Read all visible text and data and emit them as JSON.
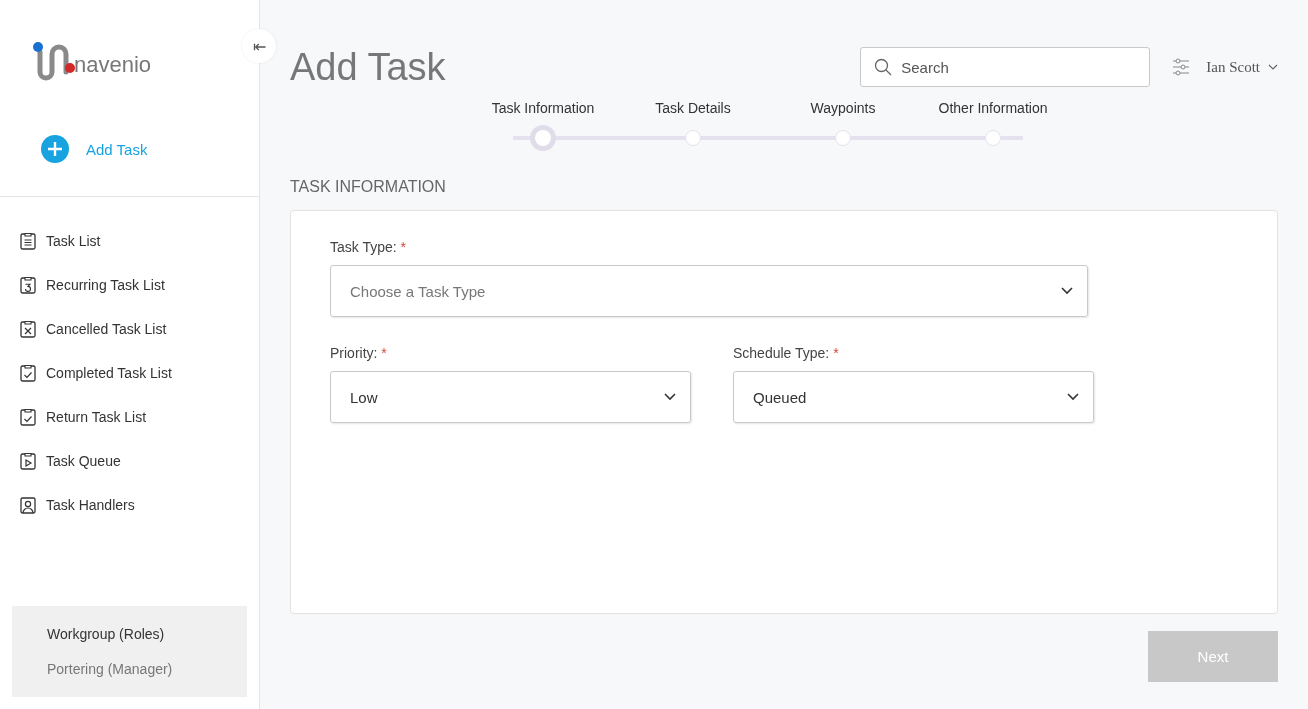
{
  "sidebar": {
    "logo_text": "navenio",
    "collapse_button": "⇤",
    "add_task": "Add Task",
    "items": [
      {
        "label": "Task List",
        "kind": "list"
      },
      {
        "label": "Recurring Task List",
        "kind": "recurring"
      },
      {
        "label": "Cancelled Task List",
        "kind": "cancelled"
      },
      {
        "label": "Completed Task List",
        "kind": "completed"
      },
      {
        "label": "Return Task List",
        "kind": "completed"
      },
      {
        "label": "Task Queue",
        "kind": "queue"
      },
      {
        "label": "Task Handlers",
        "kind": "person"
      }
    ],
    "workgroup": {
      "title": "Workgroup (Roles)",
      "role": "Portering (Manager)"
    }
  },
  "header": {
    "title": "Add Task",
    "search": {
      "placeholder": "Search"
    },
    "user": "Ian Scott"
  },
  "steps": [
    {
      "label": "Task Information",
      "selected": true
    },
    {
      "label": "Task Details",
      "selected": false
    },
    {
      "label": "Waypoints",
      "selected": false
    },
    {
      "label": "Other Information",
      "selected": false
    }
  ],
  "section_title": "TASK INFORMATION",
  "fields": [
    {
      "label": "Task Type:",
      "required": "*",
      "placeholder": "Choose a Task Type"
    },
    {
      "label": "Priority:",
      "required": "*",
      "value": "Low"
    },
    {
      "label": "Schedule Type:",
      "required": "*",
      "value": "Queued"
    }
  ],
  "next_button": {
    "label": "Next",
    "disabled": true
  }
}
